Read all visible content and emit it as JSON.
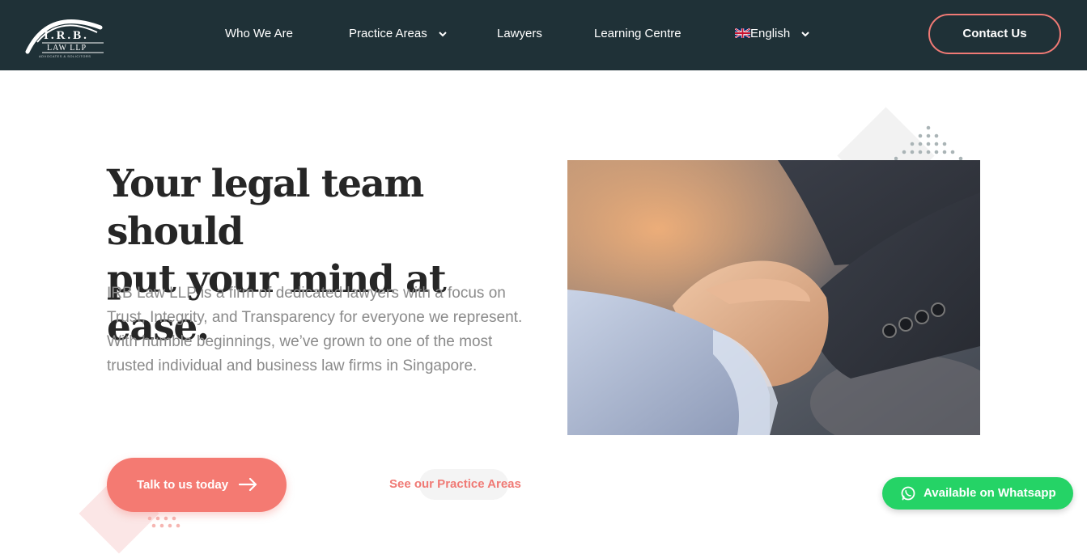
{
  "header": {
    "logo": {
      "main": "I.R.B.",
      "sub": "LAW LLP",
      "tagline": "ADVOCATES & SOLICITORS"
    },
    "nav": [
      {
        "label": "Who We Are",
        "has_dropdown": false
      },
      {
        "label": "Practice Areas",
        "has_dropdown": true
      },
      {
        "label": "Lawyers",
        "has_dropdown": false
      },
      {
        "label": "Learning Centre",
        "has_dropdown": false
      },
      {
        "label": "English",
        "has_dropdown": true,
        "icon": "uk-flag-icon"
      }
    ],
    "contact_label": "Contact Us"
  },
  "hero": {
    "title_line1": "Your legal team should",
    "title_line2": "put your mind at ease.",
    "description": "IRB Law LLP is a firm of dedicated lawyers with a focus on Trust, Integrity, and Transparency for everyone we represent. With humble beginnings, we’ve grown to one of the most trusted individual and business law firms in Singapore.",
    "cta_label": "Talk to us today",
    "secondary_link": "See our Practice Areas",
    "image": "handshake-photo"
  },
  "whatsapp": {
    "label": "Available on Whatsapp",
    "icon": "whatsapp-icon"
  },
  "colors": {
    "header_bg": "#1f3137",
    "accent": "#f47a72",
    "title": "#262626",
    "body_text": "#8a8a8a",
    "whatsapp": "#25d366"
  }
}
